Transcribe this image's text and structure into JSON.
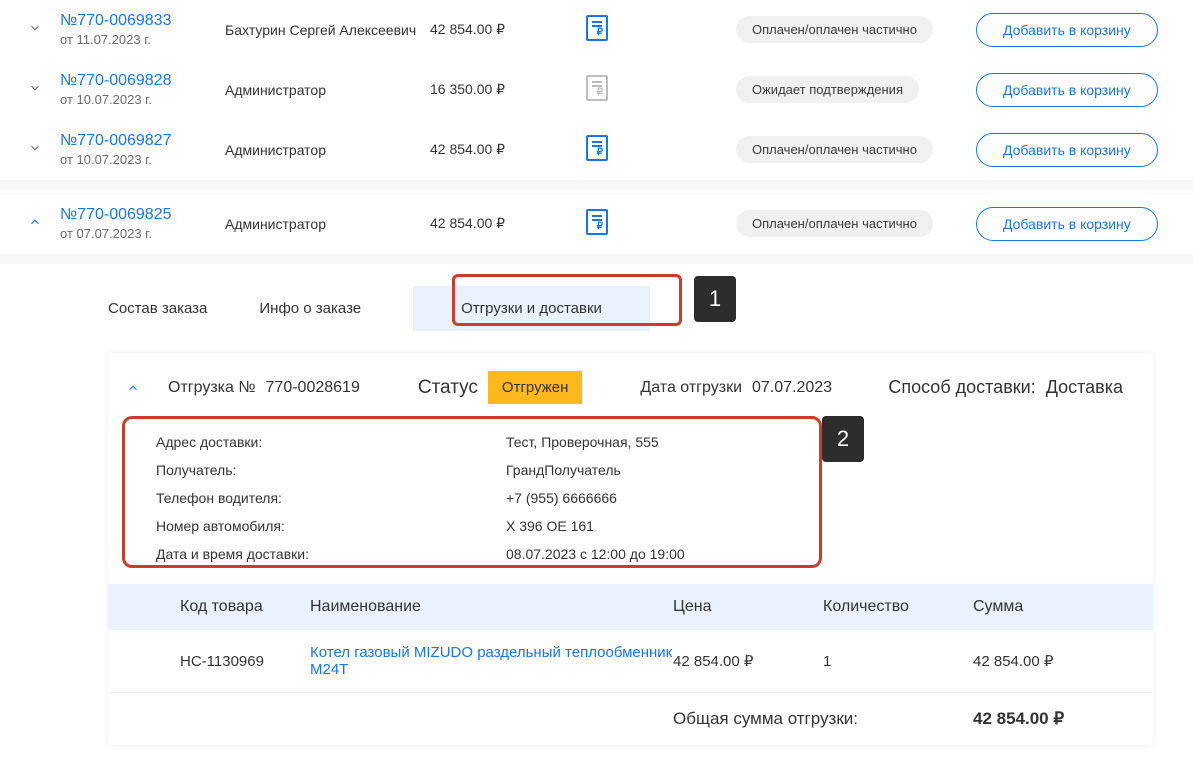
{
  "orders": [
    {
      "num": "№770-0069833",
      "date": "от 11.07.2023 г.",
      "client": "Бахтурин Сергей Алексеевич",
      "amount": "42 854.00 ₽",
      "status": "Оплачен/оплачен частично",
      "doc_active": true,
      "cart": "Добавить в корзину",
      "expanded": false
    },
    {
      "num": "№770-0069828",
      "date": "от 10.07.2023 г.",
      "client": "Администратор",
      "amount": "16 350.00 ₽",
      "status": "Ожидает подтверждения",
      "doc_active": false,
      "cart": "Добавить в корзину",
      "expanded": false
    },
    {
      "num": "№770-0069827",
      "date": "от 10.07.2023 г.",
      "client": "Администратор",
      "amount": "42 854.00 ₽",
      "status": "Оплачен/оплачен частично",
      "doc_active": true,
      "cart": "Добавить в корзину",
      "expanded": false
    },
    {
      "num": "№770-0069825",
      "date": "от 07.07.2023 г.",
      "client": "Администратор",
      "amount": "42 854.00 ₽",
      "status": "Оплачен/оплачен частично",
      "doc_active": true,
      "cart": "Добавить в корзину",
      "expanded": true
    }
  ],
  "tabs": {
    "composition": "Состав заказа",
    "info": "Инфо о заказе",
    "shipments": "Отгрузки и доставки"
  },
  "shipment": {
    "label": "Отгрузка №",
    "num": "770-0028619",
    "status_label": "Статус",
    "status_value": "Отгружен",
    "date_label": "Дата отгрузки",
    "date_value": "07.07.2023",
    "delivery_method_label": "Способ доставки:",
    "delivery_method_value": "Доставка",
    "info": [
      {
        "k": "Адрес доставки:",
        "v": "Тест, Проверочная, 555"
      },
      {
        "k": "Получатель:",
        "v": "ГрандПолучатель"
      },
      {
        "k": "Телефон водителя:",
        "v": "+7 (955) 6666666"
      },
      {
        "k": "Номер автомобиля:",
        "v": "X 396 OE 161"
      },
      {
        "k": "Дата и время доставки:",
        "v": "08.07.2023 с 12:00 до 19:00"
      }
    ]
  },
  "items_table": {
    "headers": {
      "code": "Код товара",
      "name": "Наименование",
      "price": "Цена",
      "qty": "Количество",
      "sum": "Сумма"
    },
    "rows": [
      {
        "code": "НС-1130969",
        "name": "Котел газовый MIZUDO раздельный теплообменник M24T",
        "price": "42 854.00 ₽",
        "qty": "1",
        "sum": "42 854.00 ₽"
      }
    ],
    "total_label": "Общая сумма отгрузки:",
    "total_value": "42 854.00 ₽"
  },
  "annot": {
    "n1": "1",
    "n2": "2"
  }
}
